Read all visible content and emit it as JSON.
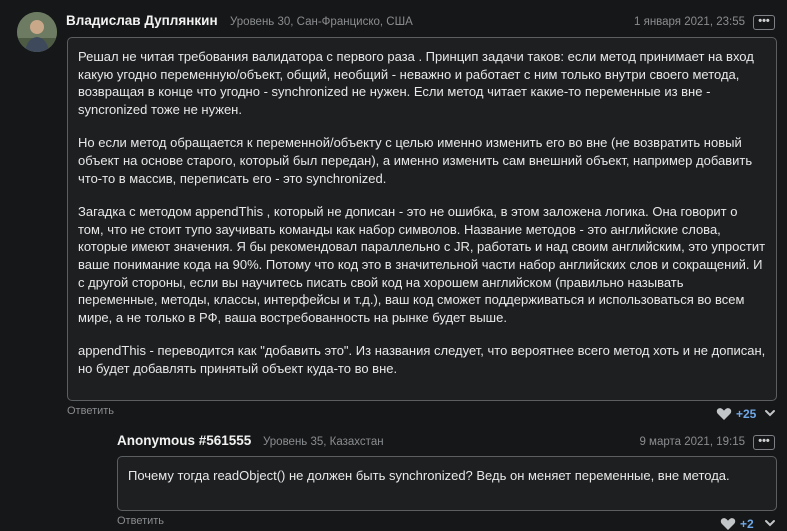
{
  "comment1": {
    "author": "Владислав Дуплянкин",
    "meta": "Уровень 30, Сан-Франциско, США",
    "date": "1 января 2021, 23:55",
    "more": "•••",
    "paragraphs": [
      "Решал не читая требования валидатора с первого раза . Принцип задачи таков: если метод принимает на вход какую угодно переменную/объект, общий, необщий - неважно  и работает с ним только внутри своего метода, возвращая в конце что угодно - synchronized не нужен. Если метод читает какие-то переменные из вне - syncronized тоже не нужен.",
      "Но если метод обращается к переменной/объекту с целью именно изменить его во вне (не возвратить новый объект на основе старого, который был передан), а именно изменить сам внешний объект, например добавить что-то в массив, переписать его - это synchronized.",
      "Загадка с методом  appendThis , который не дописан - это не ошибка, в этом заложена логика. Она говорит о том, что не стоит тупо заучивать команды как набор символов. Название методов - это английские слова, которые имеют значения. Я бы рекомендовал параллельно с JR, работать и над своим английским, это упростит ваше понимание кода на 90%. Потому что код это в значительной части набор английских слов и сокращений. И с другой стороны, если вы научитесь писать свой код на хорошем английском (правильно называть переменные, методы, классы, интерфейсы и т.д.), ваш код сможет поддерживаться  и использоваться во всем мире, а не только в РФ, ваша востребованность на рынке будет выше.",
      "appendThis - переводится как \"добавить это\". Из названия следует, что вероятнее всего метод хоть и не дописан, но будет добавлять принятый объект куда-то во вне."
    ],
    "reply_label": "Ответить",
    "likes": "+25"
  },
  "comment2": {
    "author": "Anonymous #561555",
    "meta": "Уровень 35, Казахстан",
    "date": "9 марта 2021, 19:15",
    "more": "•••",
    "text": "Почему тогда readObject() не должен быть synchronized? Ведь он меняет переменные, вне метода.",
    "reply_label": "Ответить",
    "likes": "+2"
  },
  "icons": {
    "like": "heart-icon",
    "expand": "chevron-down-icon",
    "menu": "more-dots-icon"
  },
  "colors": {
    "background": "#161718",
    "bubble_border": "#5c5f62",
    "likes": "#6fa8e8"
  }
}
